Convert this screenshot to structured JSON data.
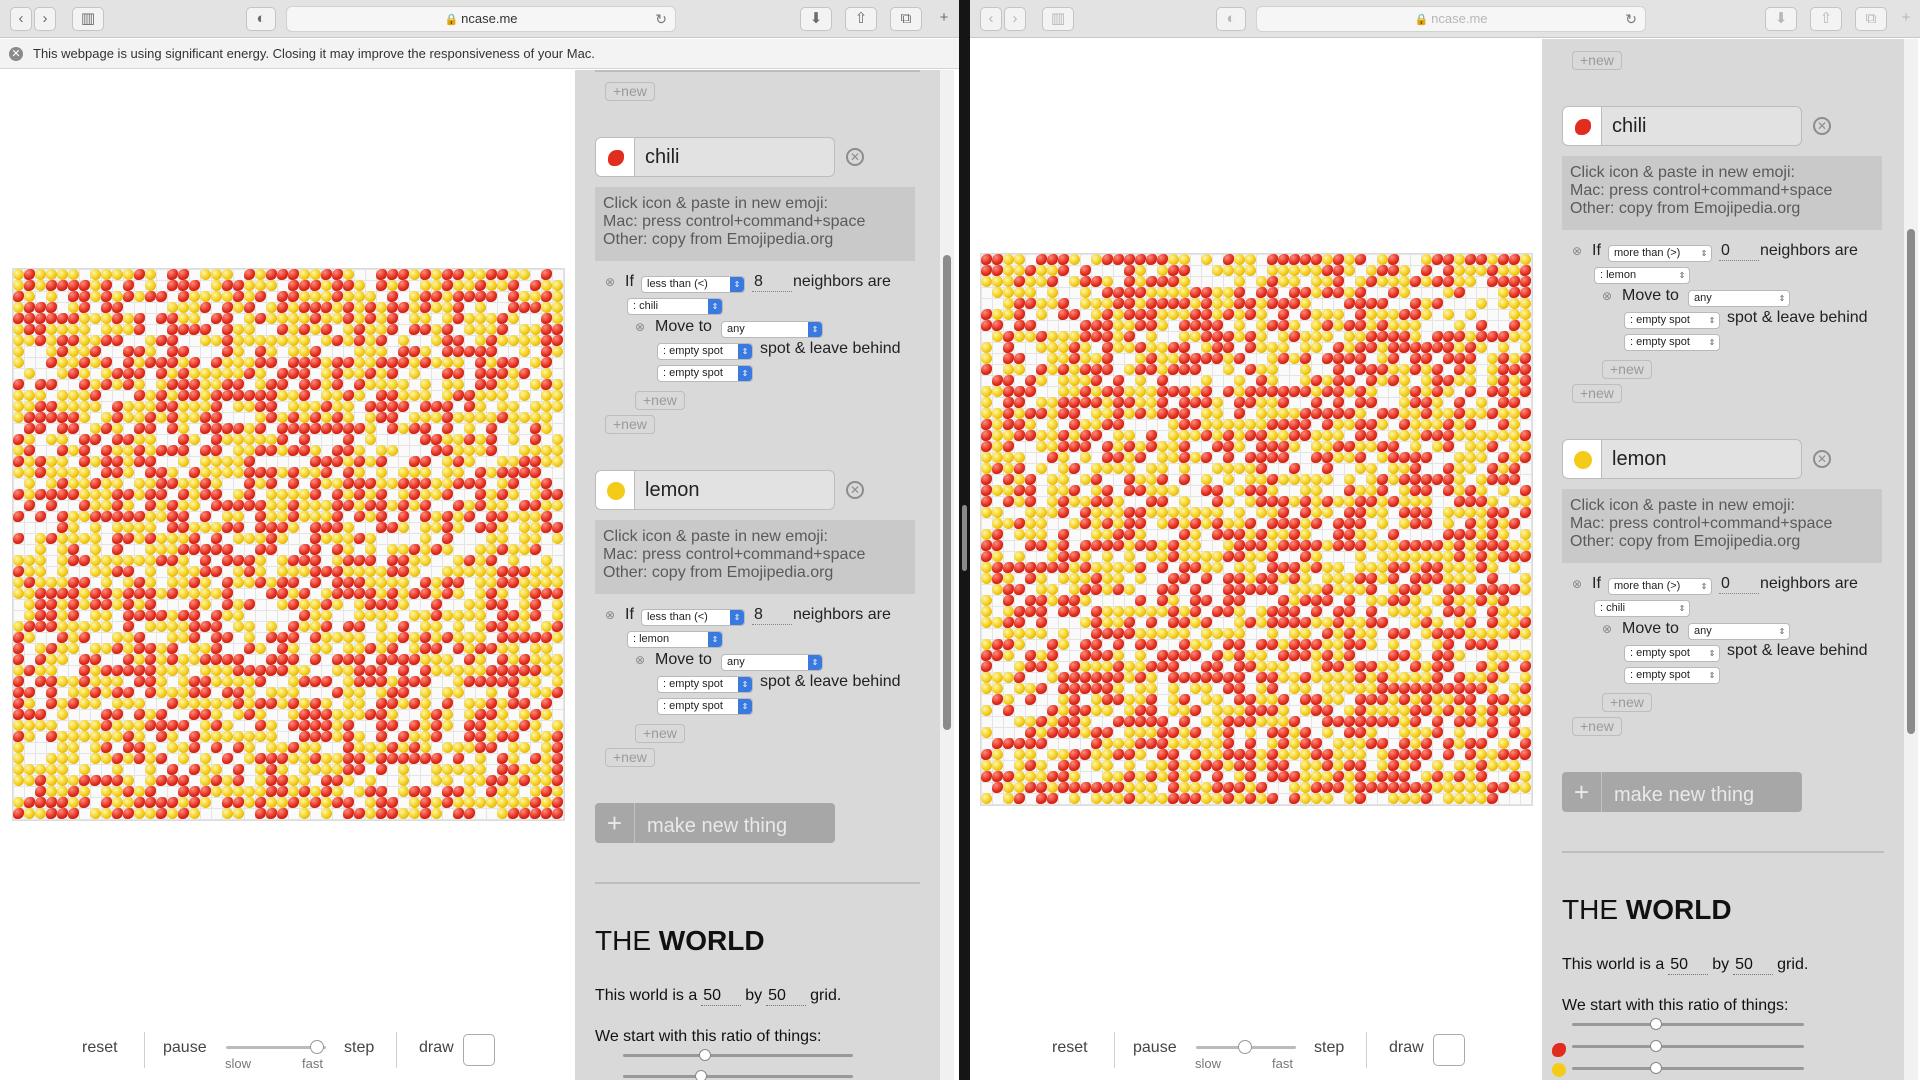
{
  "browser": {
    "url": "ncase.me"
  },
  "banner": {
    "text": "This webpage is using significant energy. Closing it may improve the responsiveness of your Mac."
  },
  "controls": {
    "reset": "reset",
    "pause": "pause",
    "slow": "slow",
    "fast": "fast",
    "step": "step",
    "draw": "draw"
  },
  "left_panel": {
    "new_label": "+new",
    "help": [
      "Click icon & paste in new emoji:",
      "Mac: press control+command+space",
      "Other: copy from Emojipedia.org"
    ],
    "things": [
      {
        "name": "chili",
        "icon": "chili-pepper-icon",
        "rule": {
          "if": "If",
          "cmp": "less than (<)",
          "count": "8",
          "neighbors": "neighbors are",
          "of": ": chili",
          "move": "Move to",
          "dir": "any",
          "spot1": ": empty spot",
          "spot_text": "spot & leave behind",
          "spot2": ": empty spot"
        }
      },
      {
        "name": "lemon",
        "icon": "lemon-icon",
        "rule": {
          "if": "If",
          "cmp": "less than (<)",
          "count": "8",
          "neighbors": "neighbors are",
          "of": ": lemon",
          "move": "Move to",
          "dir": "any",
          "spot1": ": empty spot",
          "spot_text": "spot & leave behind",
          "spot2": ": empty spot"
        }
      }
    ],
    "make_new": "make new thing",
    "world": {
      "title_the": "THE",
      "title_world": "WORLD",
      "line_pre": "This world is a",
      "w": "50",
      "by": "by",
      "h": "50",
      "grid": "grid.",
      "ratio": "We start with this ratio of things:"
    }
  },
  "right_panel": {
    "new_label": "+new",
    "help": [
      "Click icon & paste in new emoji:",
      "Mac: press control+command+space",
      "Other: copy from Emojipedia.org"
    ],
    "things": [
      {
        "name": "chili",
        "icon": "chili-pepper-icon",
        "rule": {
          "if": "If",
          "cmp": "more than (>)",
          "count": "0",
          "neighbors": "neighbors are",
          "of": ": lemon",
          "move": "Move to",
          "dir": "any",
          "spot1": ": empty spot",
          "spot_text": "spot & leave behind",
          "spot2": ": empty spot"
        }
      },
      {
        "name": "lemon",
        "icon": "lemon-icon",
        "rule": {
          "if": "If",
          "cmp": "more than (>)",
          "count": "0",
          "neighbors": "neighbors are",
          "of": ": chili",
          "move": "Move to",
          "dir": "any",
          "spot1": ": empty spot",
          "spot_text": "spot & leave behind",
          "spot2": ": empty spot"
        }
      }
    ],
    "make_new": "make new thing",
    "world": {
      "title_the": "THE",
      "title_world": "WORLD",
      "line_pre": "This world is a",
      "w": "50",
      "by": "by",
      "h": "50",
      "grid": "grid.",
      "ratio": "We start with this ratio of things:"
    }
  },
  "colors": {
    "chili": "#e12d1d",
    "lemon": "#f3cb18",
    "panel": "#d9d9d9"
  }
}
